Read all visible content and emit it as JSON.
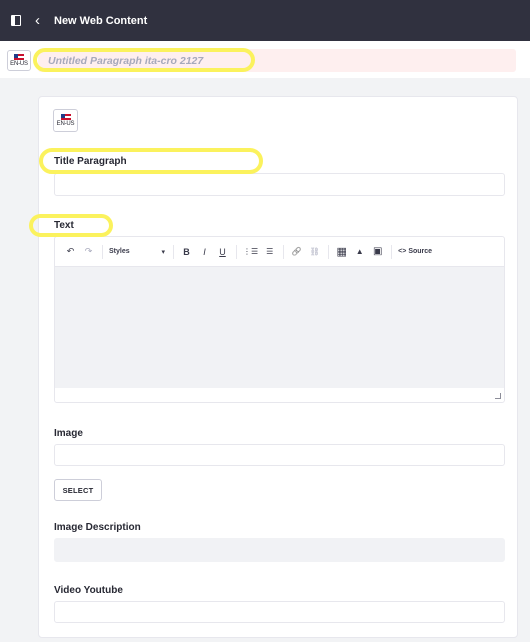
{
  "header": {
    "back_icon": "chevron-left-icon",
    "panel_icon": "sidebar-toggle-icon",
    "title": "New Web Content"
  },
  "title_field": {
    "locale": "EN-US",
    "placeholder": "Untitled Paragraph ita-cro 2127"
  },
  "card_locale": "EN-US",
  "fields": {
    "title_paragraph_label": "Title Paragraph",
    "text_label": "Text",
    "image_label": "Image",
    "select_button": "SELECT",
    "image_description_label": "Image Description",
    "video_youtube_label": "Video Youtube"
  },
  "editor_toolbar": {
    "styles_label": "Styles",
    "source_label": "Source",
    "undo": "↶",
    "redo": "↷",
    "bold": "B",
    "italic": "I",
    "underline": "U",
    "ordered_list": "⋮☰",
    "unordered_list": "☰",
    "link": "🔗",
    "unlink": "⛓",
    "table": "▦",
    "image": "▲",
    "video": "▣",
    "source_icon": "<>"
  },
  "highlight_color": "#fbf25d",
  "accent_colors": {
    "topbar": "#30313f",
    "title_field_bg": "#feefef"
  }
}
